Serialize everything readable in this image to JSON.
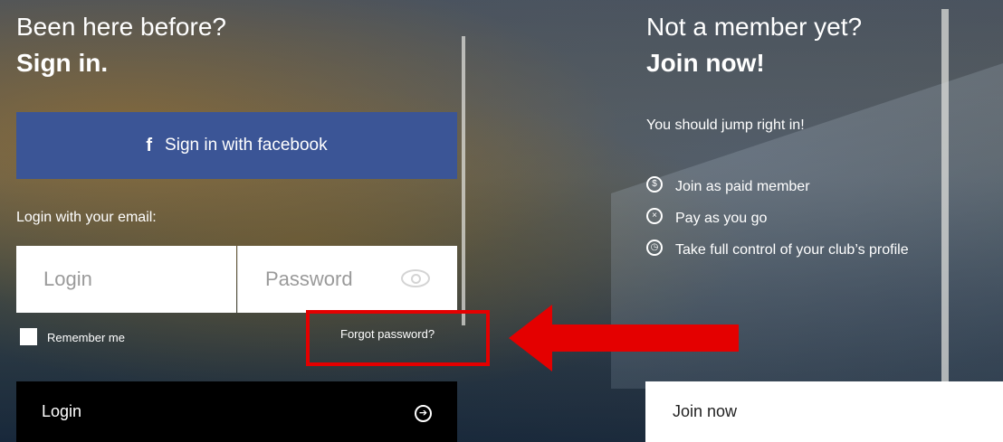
{
  "signin": {
    "heading_line1": "Been here before?",
    "heading_line2": "Sign in.",
    "facebook_icon": "f",
    "facebook_label": "Sign in with facebook",
    "email_label": "Login with your email:",
    "login_placeholder": "Login",
    "password_placeholder": "Password",
    "remember_label": "Remember me",
    "forgot_label": "Forgot password?",
    "login_button": "Login",
    "login_arrow_icon": "➔"
  },
  "join": {
    "heading_line1": "Not a member yet?",
    "heading_line2": "Join now!",
    "intro": "You should jump right in!",
    "features": [
      {
        "icon": "member-icon",
        "label": "Join as paid member"
      },
      {
        "icon": "pay-icon",
        "label": "Pay as you go"
      },
      {
        "icon": "control-icon",
        "label": "Take full control of your club’s profile"
      }
    ],
    "join_button": "Join now"
  },
  "annotation": {
    "color": "#e40000"
  }
}
